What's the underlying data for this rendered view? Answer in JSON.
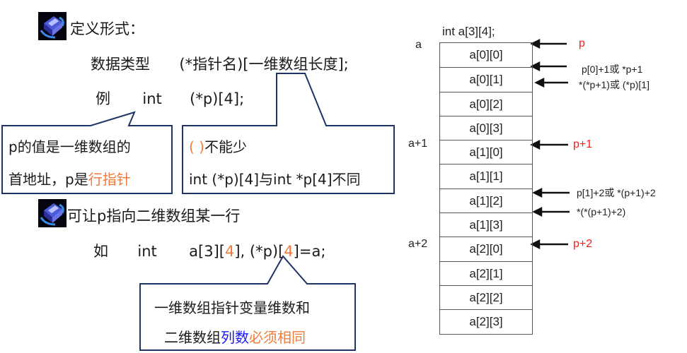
{
  "section1": {
    "icon": "book-bullet-icon",
    "heading": "定义形式：",
    "syntax": {
      "type": "数据类型",
      "ptr": "(*指针名)",
      "dim": "[一维数组长度];"
    },
    "example": {
      "label": "例",
      "kw": "int",
      "decl": "(*p)[4];"
    }
  },
  "callout_left": {
    "line1": "p的值是一维数组的",
    "line2_plain": "首地址，p是",
    "line2_highlight": "行指针"
  },
  "callout_middle": {
    "line1_highlight": "( )",
    "line1_plain": "不能少",
    "line2": "int (*p)[4]与int *p[4]不同"
  },
  "section2": {
    "icon": "book-bullet-icon",
    "heading": "可让p指向二维数组某一行",
    "example": {
      "label": "如",
      "kw": "int",
      "part1": "a[3][",
      "part1_hl": "4",
      "part2": "],  (*p)[",
      "part2_hl": "4",
      "part3": "]=a;"
    }
  },
  "callout_bottom": {
    "line1": "一维数组指针变量维数和",
    "line2_plain": "二维数组",
    "line2_blue": "列数",
    "line2_orange": "必须相同"
  },
  "memory": {
    "decl": "int  a[3][4];",
    "cells": [
      "a[0][0]",
      "a[0][1]",
      "a[0][2]",
      "a[0][3]",
      "a[1][0]",
      "a[1][1]",
      "a[1][2]",
      "a[1][3]",
      "a[2][0]",
      "a[2][1]",
      "a[2][2]",
      "a[2][3]"
    ],
    "row_labels": [
      "a",
      "a+1",
      "a+2"
    ],
    "pointers": [
      {
        "label": "p",
        "color": "red"
      },
      {
        "label": "p[0]+1或 *p+1",
        "color": "black"
      },
      {
        "label": "*(*p+1)或 (*p)[1]",
        "color": "black"
      },
      {
        "label": "p+1",
        "color": "red"
      },
      {
        "label": "p[1]+2或 *(p+1)+2",
        "color": "black"
      },
      {
        "label": "*(*(p+1)+2)",
        "color": "black"
      },
      {
        "label": "p+2",
        "color": "red"
      }
    ]
  },
  "colors": {
    "highlight_orange": "#f07b3a",
    "highlight_blue": "#1a1aff",
    "pointer_red": "#ff1a1a",
    "callout_border": "#1f3466"
  }
}
